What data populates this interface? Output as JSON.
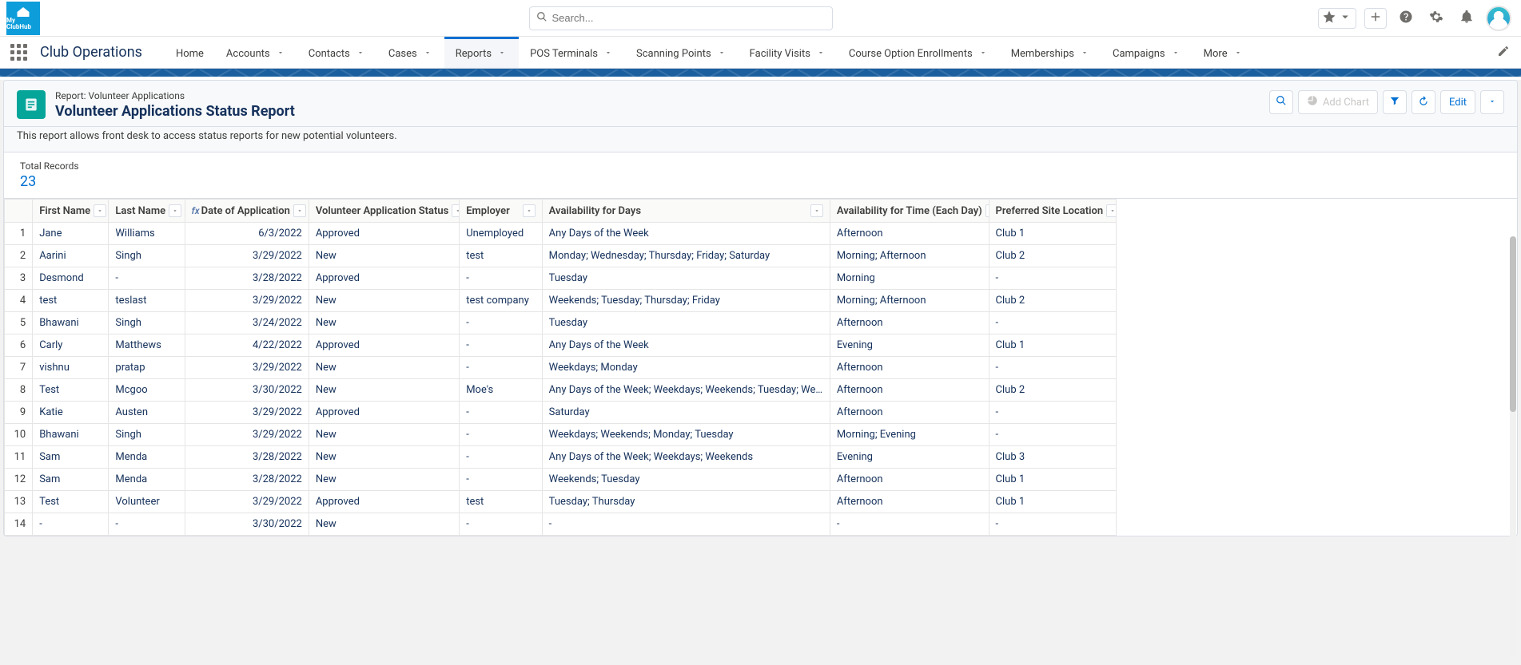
{
  "logo_text": "My ClubHub",
  "search": {
    "placeholder": "Search..."
  },
  "app_name": "Club Operations",
  "nav": {
    "items": [
      {
        "label": "Home",
        "dropdown": false
      },
      {
        "label": "Accounts",
        "dropdown": true
      },
      {
        "label": "Contacts",
        "dropdown": true
      },
      {
        "label": "Cases",
        "dropdown": true
      },
      {
        "label": "Reports",
        "dropdown": true,
        "active": true
      },
      {
        "label": "POS Terminals",
        "dropdown": true
      },
      {
        "label": "Scanning Points",
        "dropdown": true
      },
      {
        "label": "Facility Visits",
        "dropdown": true
      },
      {
        "label": "Course Option Enrollments",
        "dropdown": true
      },
      {
        "label": "Memberships",
        "dropdown": true
      },
      {
        "label": "Campaigns",
        "dropdown": true
      },
      {
        "label": "More",
        "dropdown": true
      }
    ]
  },
  "page_header": {
    "crumb": "Report: Volunteer Applications",
    "title": "Volunteer Applications Status Report",
    "description": "This report allows front desk to access status reports for new potential volunteers.",
    "add_chart_label": "Add Chart",
    "edit_label": "Edit"
  },
  "totals": {
    "label": "Total Records",
    "value": "23"
  },
  "columns": [
    {
      "label": "First Name",
      "fx": false
    },
    {
      "label": "Last Name",
      "fx": false
    },
    {
      "label": "Date of Application",
      "fx": true
    },
    {
      "label": "Volunteer Application Status",
      "fx": false
    },
    {
      "label": "Employer",
      "fx": false
    },
    {
      "label": "Availability for Days",
      "fx": false
    },
    {
      "label": "Availability for Time (Each Day)",
      "fx": false
    },
    {
      "label": "Preferred Site Location",
      "fx": false
    }
  ],
  "rows": [
    {
      "n": "1",
      "first": "Jane",
      "last": "Williams",
      "date": "6/3/2022",
      "status": "Approved",
      "employer": "Unemployed",
      "days": "Any Days of the Week",
      "time": "Afternoon",
      "site": "Club 1"
    },
    {
      "n": "2",
      "first": "Aarini",
      "last": "Singh",
      "date": "3/29/2022",
      "status": "New",
      "employer": "test",
      "days": "Monday; Wednesday; Thursday; Friday; Saturday",
      "time": "Morning; Afternoon",
      "site": "Club 2"
    },
    {
      "n": "3",
      "first": "Desmond",
      "last": "-",
      "date": "3/28/2022",
      "status": "Approved",
      "employer": "-",
      "days": "Tuesday",
      "time": "Morning",
      "site": "-"
    },
    {
      "n": "4",
      "first": "test",
      "last": "teslast",
      "date": "3/29/2022",
      "status": "New",
      "employer": "test company",
      "days": "Weekends; Tuesday; Thursday; Friday",
      "time": "Morning; Afternoon",
      "site": "Club 2"
    },
    {
      "n": "5",
      "first": "Bhawani",
      "last": "Singh",
      "date": "3/24/2022",
      "status": "New",
      "employer": "-",
      "days": "Tuesday",
      "time": "Afternoon",
      "site": "-"
    },
    {
      "n": "6",
      "first": "Carly",
      "last": "Matthews",
      "date": "4/22/2022",
      "status": "Approved",
      "employer": "-",
      "days": "Any Days of the Week",
      "time": "Evening",
      "site": "Club 1"
    },
    {
      "n": "7",
      "first": "vishnu",
      "last": "pratap",
      "date": "3/29/2022",
      "status": "New",
      "employer": "-",
      "days": "Weekdays; Monday",
      "time": "Afternoon",
      "site": "-"
    },
    {
      "n": "8",
      "first": "Test",
      "last": "Mcgoo",
      "date": "3/30/2022",
      "status": "New",
      "employer": "Moe's",
      "days": "Any Days of the Week; Weekdays; Weekends; Tuesday; Wednesday",
      "time": "Afternoon",
      "site": "Club 2"
    },
    {
      "n": "9",
      "first": "Katie",
      "last": "Austen",
      "date": "3/29/2022",
      "status": "Approved",
      "employer": "-",
      "days": "Saturday",
      "time": "Afternoon",
      "site": "-"
    },
    {
      "n": "10",
      "first": "Bhawani",
      "last": "Singh",
      "date": "3/29/2022",
      "status": "New",
      "employer": "-",
      "days": "Weekdays; Weekends; Monday; Tuesday",
      "time": "Morning; Evening",
      "site": "-"
    },
    {
      "n": "11",
      "first": "Sam",
      "last": "Menda",
      "date": "3/28/2022",
      "status": "New",
      "employer": "-",
      "days": "Any Days of the Week; Weekdays; Weekends",
      "time": "Evening",
      "site": "Club 3"
    },
    {
      "n": "12",
      "first": "Sam",
      "last": "Menda",
      "date": "3/28/2022",
      "status": "New",
      "employer": "-",
      "days": "Weekends; Tuesday",
      "time": "Afternoon",
      "site": "Club 1"
    },
    {
      "n": "13",
      "first": "Test",
      "last": "Volunteer",
      "date": "3/29/2022",
      "status": "Approved",
      "employer": "test",
      "days": "Tuesday; Thursday",
      "time": "Afternoon",
      "site": "Club 1"
    },
    {
      "n": "14",
      "first": "-",
      "last": "-",
      "date": "3/30/2022",
      "status": "New",
      "employer": "-",
      "days": "-",
      "time": "-",
      "site": "-"
    }
  ]
}
